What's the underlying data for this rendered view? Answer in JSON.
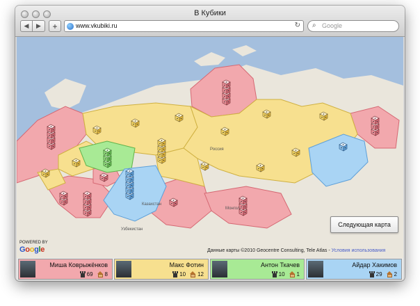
{
  "window": {
    "title": "В Кубики",
    "address_url": "www.vkubiki.ru",
    "search_placeholder": "Google"
  },
  "map": {
    "next_map_label": "Следующая карта",
    "attribution": "Данные карты ©2010 Geocentre Consulting, Tele Atlas - ",
    "terms_link": "Условия использования",
    "powered_by": "POWERED BY",
    "logo_text": "Google",
    "labels": {
      "russia": "Россия",
      "kazakhstan": "Казахстан",
      "mongolia": "Монголия",
      "uzbekistan": "Узбекистан"
    },
    "player_colors": {
      "red": "#f2a8ad",
      "yellow": "#f7e08f",
      "green": "#a8ea95",
      "blue": "#a9d4f4"
    }
  },
  "players": [
    {
      "name": "Миша Коврыжёнков",
      "dice": "69",
      "houses": "8",
      "color": "#f2a8ad"
    },
    {
      "name": "Макс Фотин",
      "dice": "10",
      "houses": "12",
      "color": "#f7e08f"
    },
    {
      "name": "Антон Ткачев",
      "dice": "10",
      "houses": "1",
      "color": "#a8ea95"
    },
    {
      "name": "Айдар Хакимов",
      "dice": "29",
      "houses": "2",
      "color": "#a9d4f4"
    }
  ]
}
